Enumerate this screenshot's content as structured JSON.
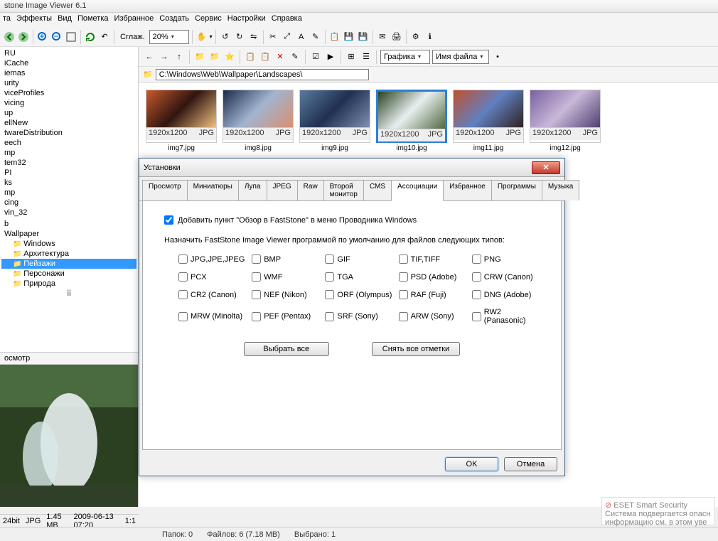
{
  "app_title": "stone Image Viewer 6.1",
  "menu": [
    "та",
    "Эффекты",
    "Вид",
    "Пометка",
    "Избранное",
    "Создать",
    "Сервис",
    "Настройки",
    "Справка"
  ],
  "toolbar1": {
    "smooth_label": "Сглаж.",
    "zoom": "20%"
  },
  "toolbar2": {
    "view_dropdown": "Графика",
    "sort_dropdown": "Имя файла"
  },
  "address": {
    "path": "C:\\Windows\\Web\\Wallpaper\\Landscapes\\"
  },
  "tree": [
    "RU",
    "iCache",
    "iemas",
    "urity",
    "viceProfiles",
    "vicing",
    "up",
    "ellNew",
    "twareDistribution",
    "eech",
    "mp",
    "tem32",
    "PI",
    "ks",
    "mp",
    "cing",
    "vin_32",
    "",
    "b",
    "Wallpaper"
  ],
  "tree_subfolders": [
    "Windows",
    "Архитектура",
    "Пейзажи",
    "Персонажи",
    "Природа"
  ],
  "tree_selected": "Пейзажи",
  "preview_label": "осмотр",
  "thumbnails": [
    {
      "name": "img7.jpg",
      "dim": "1920x1200",
      "fmt": "JPG",
      "colors": [
        "#c75a2c",
        "#301510",
        "#f0c080"
      ]
    },
    {
      "name": "img8.jpg",
      "dim": "1920x1200",
      "fmt": "JPG",
      "colors": [
        "#1a2a4a",
        "#a0b4d0",
        "#d89070"
      ]
    },
    {
      "name": "img9.jpg",
      "dim": "1920x1200",
      "fmt": "JPG",
      "colors": [
        "#5a7aa0",
        "#203050",
        "#8090b0"
      ]
    },
    {
      "name": "img10.jpg",
      "dim": "1920x1200",
      "fmt": "JPG",
      "colors": [
        "#2a4020",
        "#e8f0f0",
        "#506840"
      ],
      "selected": true
    },
    {
      "name": "img11.jpg",
      "dim": "1920x1200",
      "fmt": "JPG",
      "colors": [
        "#c05030",
        "#6080c0",
        "#302020"
      ]
    },
    {
      "name": "img12.jpg",
      "dim": "1920x1200",
      "fmt": "JPG",
      "colors": [
        "#7a60a0",
        "#c8b8d8",
        "#504070"
      ]
    }
  ],
  "dialog": {
    "title": "Установки",
    "tabs": [
      "Просмотр",
      "Миниатюры",
      "Лупа",
      "JPEG",
      "Raw",
      "Второй монитор",
      "CMS",
      "Ассоциации",
      "Избранное",
      "Программы",
      "Музыка"
    ],
    "active_tab": "Ассоциации",
    "checkbox_label": "Добавить пункт \"Обзор в FastStone\" в меню Проводника Windows",
    "checkbox_checked": true,
    "instruction": "Назначить FastStone Image Viewer программой по умолчанию для файлов следующих типов:",
    "associations": [
      "JPG,JPE,JPEG",
      "BMP",
      "GIF",
      "TIF,TIFF",
      "PNG",
      "PCX",
      "WMF",
      "TGA",
      "PSD (Adobe)",
      "CRW (Canon)",
      "CR2 (Canon)",
      "NEF (Nikon)",
      "ORF (Olympus)",
      "RAF (Fuji)",
      "DNG (Adobe)",
      "MRW (Minolta)",
      "PEF (Pentax)",
      "SRF (Sony)",
      "ARW (Sony)",
      "RW2 (Panasonic)"
    ],
    "select_all": "Выбрать все",
    "deselect_all": "Снять все отметки",
    "ok": "OK",
    "cancel": "Отмена"
  },
  "left_status": {
    "bits": "24bit",
    "fmt": "JPG",
    "size": "1.45 MB",
    "date": "2009-06-13 07:20",
    "ratio": "1:1"
  },
  "statusbar": {
    "folders": "Папок: 0",
    "files": "Файлов: 6 (7.18 MB)",
    "selected": "Выбрано: 1"
  },
  "eset": {
    "title": "ESET Smart Security",
    "line1": "Система подвергается опасн",
    "line2": "информацию см. в этом уве"
  }
}
